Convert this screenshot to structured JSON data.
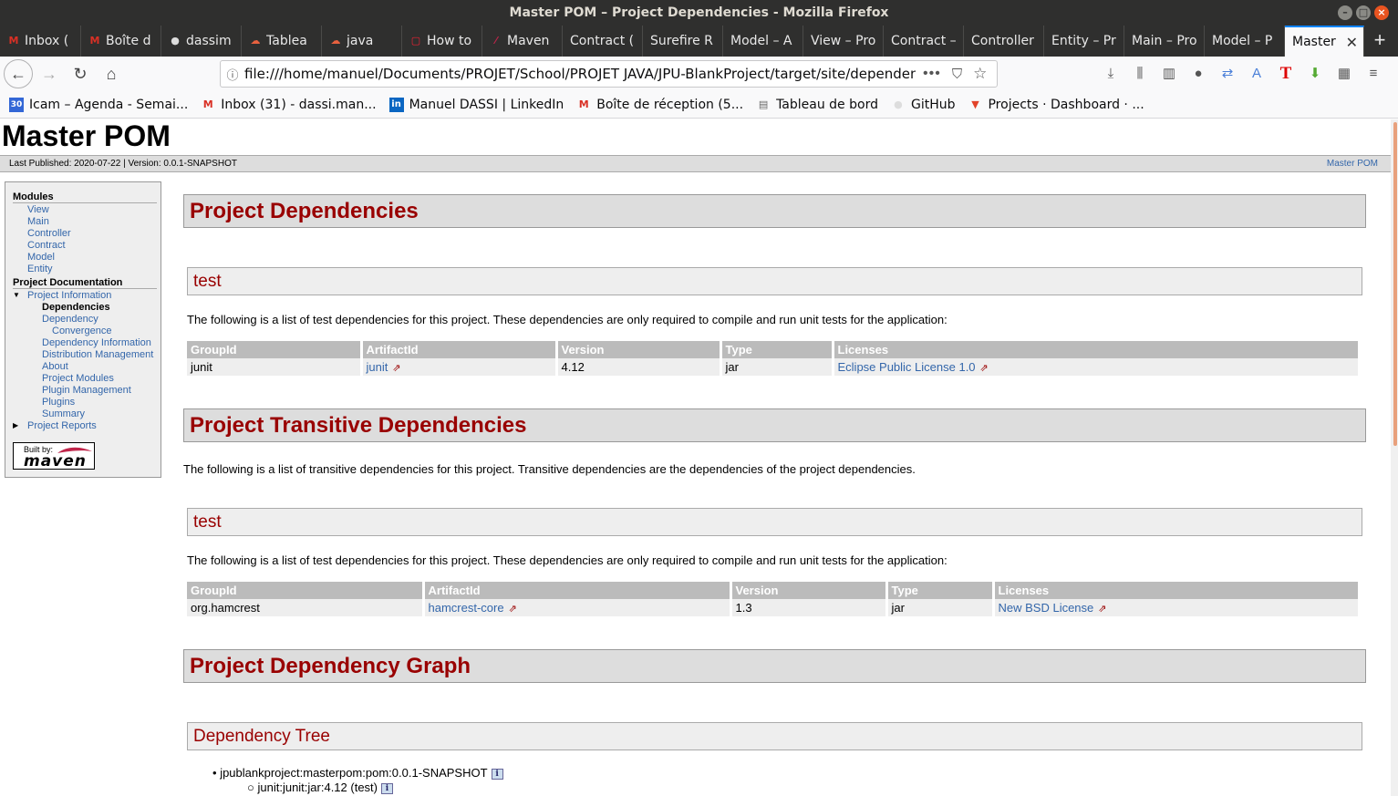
{
  "window": {
    "title": "Master POM – Project Dependencies - Mozilla Firefox"
  },
  "tabs": [
    {
      "label": "Inbox (",
      "icon": "gmail-icon"
    },
    {
      "label": "Boîte d",
      "icon": "gmail-icon"
    },
    {
      "label": "dassim",
      "icon": "github-icon"
    },
    {
      "label": "Tablea",
      "icon": "cloud-icon"
    },
    {
      "label": "java",
      "icon": "cloud-icon"
    },
    {
      "label": "How to",
      "icon": "page-icon"
    },
    {
      "label": "Maven",
      "icon": "feather-icon"
    },
    {
      "label": "Contract (",
      "icon": ""
    },
    {
      "label": "Surefire R",
      "icon": ""
    },
    {
      "label": "Model – A",
      "icon": ""
    },
    {
      "label": "View – Pro",
      "icon": ""
    },
    {
      "label": "Contract –",
      "icon": ""
    },
    {
      "label": "Controller",
      "icon": ""
    },
    {
      "label": "Entity – Pr",
      "icon": ""
    },
    {
      "label": "Main – Pro",
      "icon": ""
    },
    {
      "label": "Model – P",
      "icon": ""
    },
    {
      "label": "Master",
      "icon": "",
      "active": true
    }
  ],
  "navbar": {
    "url": "file:///home/manuel/Documents/PROJET/School/PROJET JAVA/JPU-BlankProject/target/site/dependenci"
  },
  "bookmarks": [
    {
      "label": "Icam – Agenda - Semai...",
      "icon": "calendar-icon"
    },
    {
      "label": "Inbox (31) - dassi.man...",
      "icon": "gmail-icon"
    },
    {
      "label": "Manuel DASSI | LinkedIn",
      "icon": "linkedin-icon"
    },
    {
      "label": "Boîte de réception (5...",
      "icon": "gmail-icon"
    },
    {
      "label": "Tableau de bord",
      "icon": "dashboard-icon"
    },
    {
      "label": "GitHub",
      "icon": "github-icon"
    },
    {
      "label": "Projects · Dashboard · ...",
      "icon": "gitlab-icon"
    }
  ],
  "site": {
    "title": "Master POM",
    "published": "Last Published: 2020-07-22  | Version: 0.0.1-SNAPSHOT",
    "breadcrumb_right": "Master POM"
  },
  "sidebar": {
    "modules_heading": "Modules",
    "modules": [
      "View",
      "Main",
      "Controller",
      "Contract",
      "Model",
      "Entity"
    ],
    "docs_heading": "Project Documentation",
    "project_information": "Project Information",
    "info_items": [
      {
        "label": "Dependencies",
        "current": true
      },
      {
        "label": "Dependency",
        "level": 2
      },
      {
        "label": "Convergence",
        "level": 3
      },
      {
        "label": "Dependency Information",
        "level": 2
      },
      {
        "label": "Distribution Management",
        "level": 2
      },
      {
        "label": "About",
        "level": 2
      },
      {
        "label": "Project Modules",
        "level": 2
      },
      {
        "label": "Plugin Management",
        "level": 2
      },
      {
        "label": "Plugins",
        "level": 2
      },
      {
        "label": "Summary",
        "level": 2
      }
    ],
    "project_reports": "Project Reports",
    "badge_built_by": "Built by:",
    "badge_maven": "maven"
  },
  "content": {
    "h_dependencies": "Project Dependencies",
    "h_test1": "test",
    "p_test1": "The following is a list of test dependencies for this project. These dependencies are only required to compile and run unit tests for the application:",
    "table_headers": [
      "GroupId",
      "ArtifactId",
      "Version",
      "Type",
      "Licenses"
    ],
    "table1_row": {
      "group": "junit",
      "artifact": "junit",
      "version": "4.12",
      "type": "jar",
      "license": "Eclipse Public License 1.0"
    },
    "h_transitive": "Project Transitive Dependencies",
    "p_transitive": "The following is a list of transitive dependencies for this project. Transitive dependencies are the dependencies of the project dependencies.",
    "h_test2": "test",
    "p_test2": "The following is a list of test dependencies for this project. These dependencies are only required to compile and run unit tests for the application:",
    "table2_row": {
      "group": "org.hamcrest",
      "artifact": "hamcrest-core",
      "version": "1.3",
      "type": "jar",
      "license": "New BSD License"
    },
    "h_graph": "Project Dependency Graph",
    "h_tree": "Dependency Tree",
    "tree_root": "jpublankproject:masterpom:pom:0.0.1-SNAPSHOT",
    "tree_child": "junit:junit:jar:4.12 (test)"
  }
}
